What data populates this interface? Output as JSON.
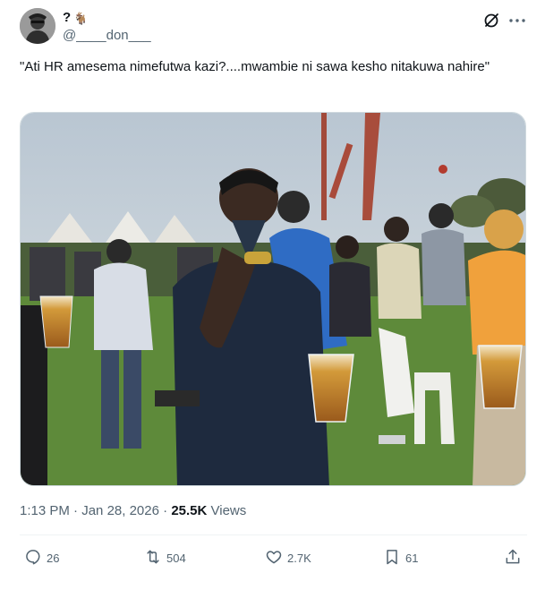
{
  "author": {
    "display_name": "?",
    "display_name_emoji": "🐐",
    "handle": "@____don___"
  },
  "header_icons": {
    "grok": "grok-icon",
    "more": "more-icon"
  },
  "tweet": {
    "text": "\"Ati HR amesema nimefutwa kazi?....mwambie ni sawa kesho nitakuwa nahire\""
  },
  "meta": {
    "time": "1:13 PM",
    "separator1": " · ",
    "date": "Jan 28, 2026",
    "separator2": " · ",
    "views_count": "25.5K",
    "views_label": " Views"
  },
  "actions": {
    "replies": "26",
    "reposts": "504",
    "likes": "2.7K",
    "bookmarks": "61"
  },
  "colors": {
    "text": "#0f1419",
    "secondary": "#536471",
    "border": "#cfd9de"
  }
}
